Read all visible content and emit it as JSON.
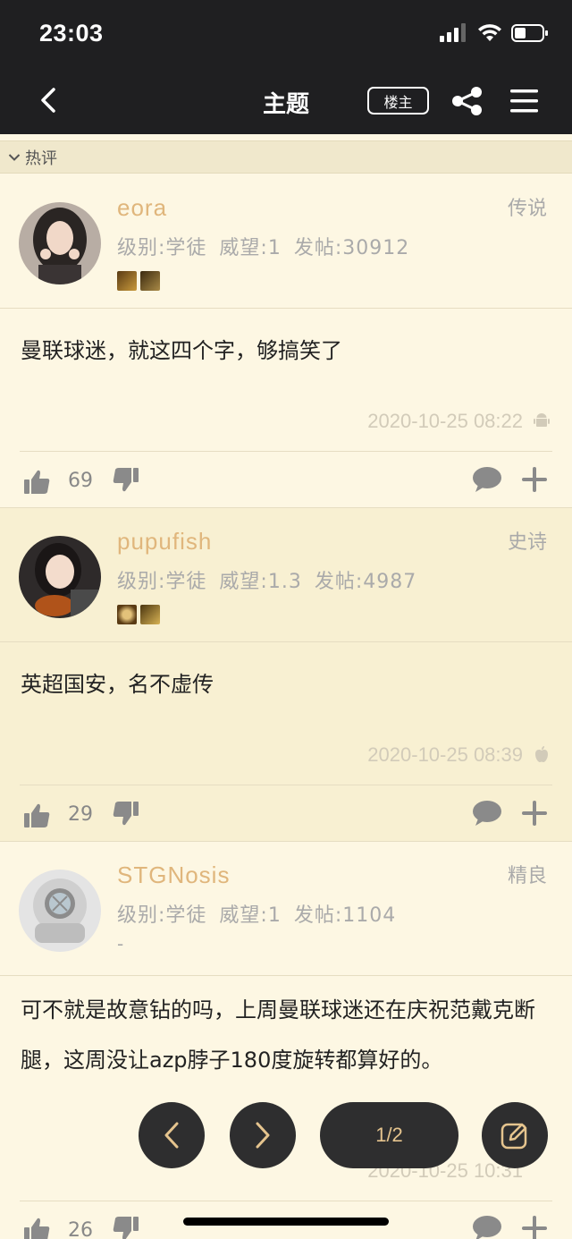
{
  "status_bar": {
    "time": "23:03"
  },
  "nav": {
    "title": "主题",
    "op_label": "楼主"
  },
  "section": {
    "label": "热评"
  },
  "posts": [
    {
      "username": "eora",
      "rank": "传说",
      "level": "级别:学徒",
      "reputation": "威望:1",
      "post_count": "发帖:30912",
      "content": "曼联球迷，就这四个字，够搞笑了",
      "timestamp": "2020-10-25 08:22",
      "platform_icon": "android-icon",
      "likes": "69"
    },
    {
      "username": "pupufish",
      "rank": "史诗",
      "level": "级别:学徒",
      "reputation": "威望:1.3",
      "post_count": "发帖:4987",
      "content": "英超国安，名不虚传",
      "timestamp": "2020-10-25 08:39",
      "platform_icon": "apple-icon",
      "likes": "29"
    },
    {
      "username": "STGNosis",
      "rank": "精良",
      "level": "级别:学徒",
      "reputation": "威望:1",
      "post_count": "发帖:1104",
      "extra": "-",
      "content": "可不就是故意钻的吗，上周曼联球迷还在庆祝范戴克断腿，这周没让azp脖子180度旋转都算好的。",
      "timestamp": "2020-10-25 10:31",
      "likes": "26"
    }
  ],
  "pager": {
    "page_label": "1/2"
  },
  "colors": {
    "header_bg": "#1f1f21",
    "page_bg": "#fdf7e3",
    "alt_bg": "#f8f0d2",
    "username": "#e0b67c",
    "button_bg": "#2e2e2f",
    "button_accent": "#e5c48e"
  }
}
